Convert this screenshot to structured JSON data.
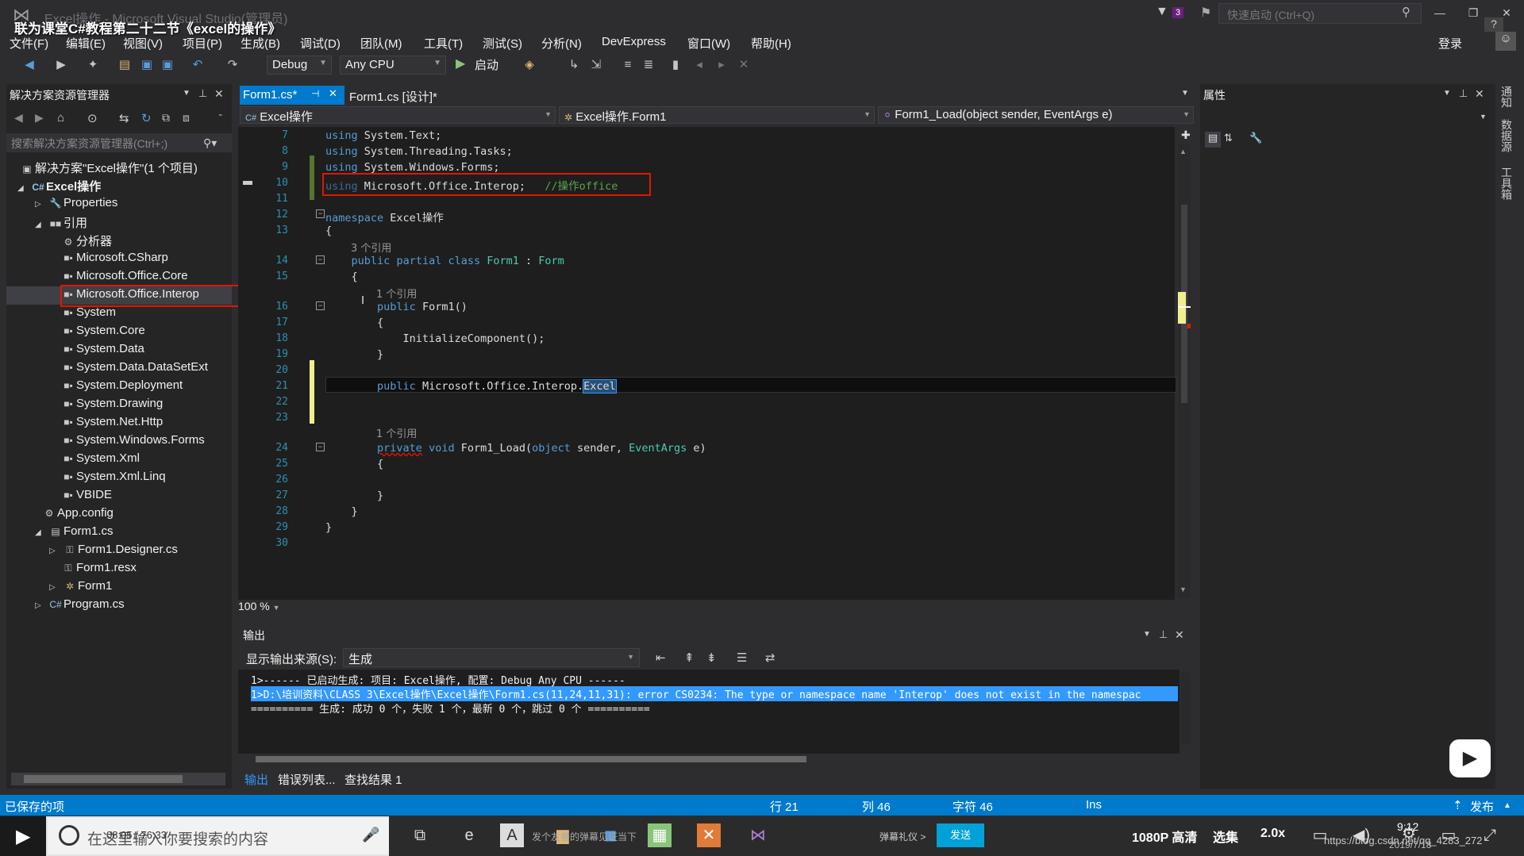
{
  "titlebar": {
    "title": "Excel操作 - Microsoft Visual Studio(管理员)",
    "overlay_title": "联为课堂C#教程第二十二节《excel的操作》",
    "quick_launch_placeholder": "快速启动 (Ctrl+Q)",
    "notification_count": "3",
    "minimize": "—",
    "restore": "❐",
    "close": "✕",
    "help": "?"
  },
  "menu": {
    "items": [
      "文件(F)",
      "编辑(E)",
      "视图(V)",
      "项目(P)",
      "生成(B)",
      "调试(D)",
      "团队(M)",
      "工具(T)",
      "测试(S)",
      "分析(N)",
      "DevExpress",
      "窗口(W)",
      "帮助(H)"
    ],
    "login": "登录"
  },
  "toolbar": {
    "config": "Debug",
    "platform": "Any CPU",
    "start_label": "启动"
  },
  "solution_explorer": {
    "title": "解决方案资源管理器",
    "search_placeholder": "搜索解决方案资源管理器(Ctrl+;)",
    "items": [
      {
        "label": "解决方案\"Excel操作\"(1 个项目)"
      },
      {
        "label": "Excel操作"
      },
      {
        "label": "Properties"
      },
      {
        "label": "引用"
      },
      {
        "label": "分析器"
      },
      {
        "label": "Microsoft.CSharp"
      },
      {
        "label": "Microsoft.Office.Core"
      },
      {
        "label": "Microsoft.Office.Interop"
      },
      {
        "label": "System"
      },
      {
        "label": "System.Core"
      },
      {
        "label": "System.Data"
      },
      {
        "label": "System.Data.DataSetExt"
      },
      {
        "label": "System.Deployment"
      },
      {
        "label": "System.Drawing"
      },
      {
        "label": "System.Net.Http"
      },
      {
        "label": "System.Windows.Forms"
      },
      {
        "label": "System.Xml"
      },
      {
        "label": "System.Xml.Linq"
      },
      {
        "label": "VBIDE"
      },
      {
        "label": "App.config"
      },
      {
        "label": "Form1.cs"
      },
      {
        "label": "Form1.Designer.cs"
      },
      {
        "label": "Form1.resx"
      },
      {
        "label": "Form1"
      },
      {
        "label": "Program.cs"
      }
    ]
  },
  "tabs": {
    "active": "Form1.cs*",
    "inactive": "Form1.cs [设计]*"
  },
  "navbar": {
    "project": "Excel操作",
    "class": "Excel操作.Form1",
    "member": "Form1_Load(object sender, EventArgs e)"
  },
  "editor": {
    "line_numbers": [
      "7",
      "8",
      "9",
      "10",
      "11",
      "12",
      "13",
      "14",
      "15",
      "16",
      "17",
      "18",
      "19",
      "20",
      "21",
      "22",
      "23",
      "24",
      "25",
      "26",
      "27",
      "28",
      "29",
      "30"
    ],
    "ref_3": "3 个引用",
    "ref_1a": "1 个引用",
    "ref_1b": "1 个引用",
    "zoom": "100 %"
  },
  "output": {
    "title": "输出",
    "source_label": "显示输出来源(S):",
    "source_value": "生成",
    "line1": "1>------ 已启动生成: 项目: Excel操作, 配置: Debug Any CPU ------",
    "line2": "1>D:\\培训资料\\CLASS 3\\Excel操作\\Excel操作\\Form1.cs(11,24,11,31): error CS0234: The type or namespace name 'Interop' does not exist in the namespac",
    "line3": "========== 生成: 成功 0 个，失败 1 个，最新 0 个，跳过 0 个 =========="
  },
  "bottom_tabs": [
    "输出",
    "错误列表...",
    "查找结果 1"
  ],
  "properties": {
    "title": "属性",
    "side_tabs": [
      "通知",
      "数据源",
      "工具箱"
    ]
  },
  "status": {
    "saved": "已保存的项",
    "row": "行 21",
    "col": "列 46",
    "char": "字符 46",
    "ins": "Ins",
    "publish": "发布"
  },
  "player": {
    "search_text": "在这里输入你要搜索的内容",
    "time": "08:05 / 76:33",
    "danmu_hint": "发个友善的弹幕见证当下",
    "gift": "弹幕礼仪 >",
    "send": "发送",
    "quality": "1080P 高清",
    "episodes": "选集",
    "speed": "2.0x",
    "clock": "9:12",
    "date": "2019/7/18",
    "watermark": "https://blog.csdn.net/qq_4283_272"
  }
}
